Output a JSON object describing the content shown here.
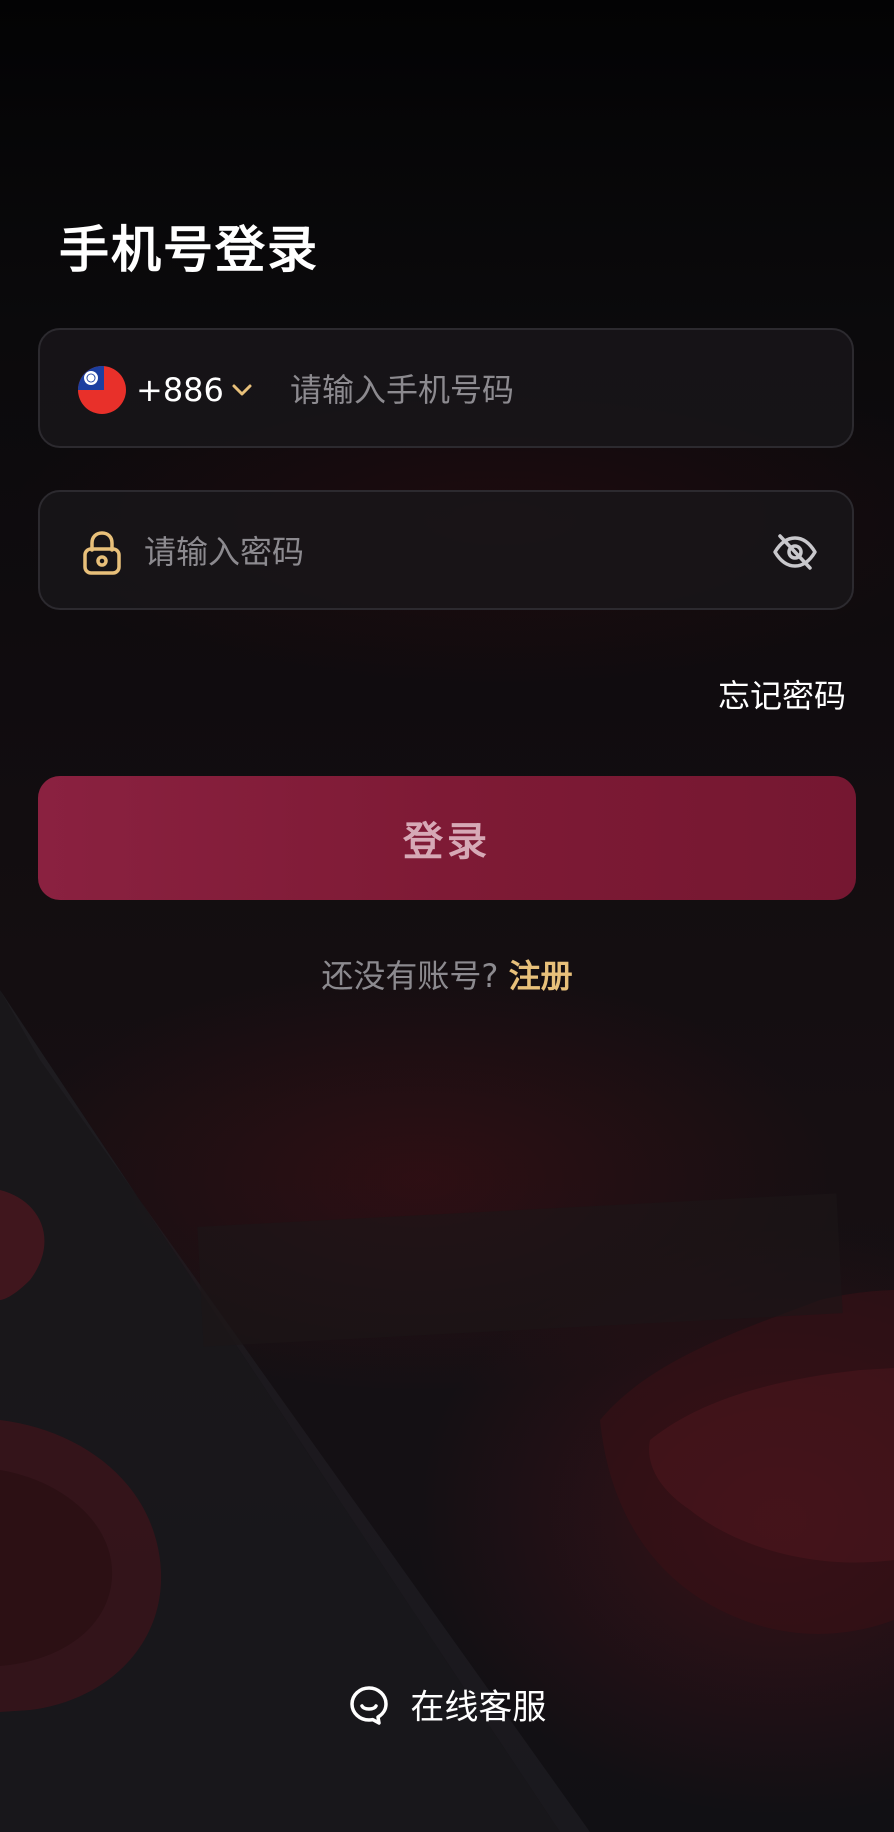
{
  "page": {
    "title": "手机号登录"
  },
  "phone": {
    "country_code": "+886",
    "flag_icon": "taiwan-flag-icon",
    "placeholder": "请输入手机号码",
    "value": ""
  },
  "password": {
    "placeholder": "请输入密码",
    "value": "",
    "lock_icon": "lock-icon",
    "toggle_icon": "eye-off-icon"
  },
  "forgot_password": "忘记密码",
  "login_button": "登录",
  "register": {
    "prompt": "还没有账号?",
    "link": "注册"
  },
  "support": {
    "label": "在线客服",
    "icon": "chat-bubble-icon"
  },
  "colors": {
    "background": "#0b0a0c",
    "accent_gold": "#e8c07a",
    "button": "#7e1a35",
    "button_text": "#d6a9b6",
    "placeholder": "#8c8a8f"
  }
}
